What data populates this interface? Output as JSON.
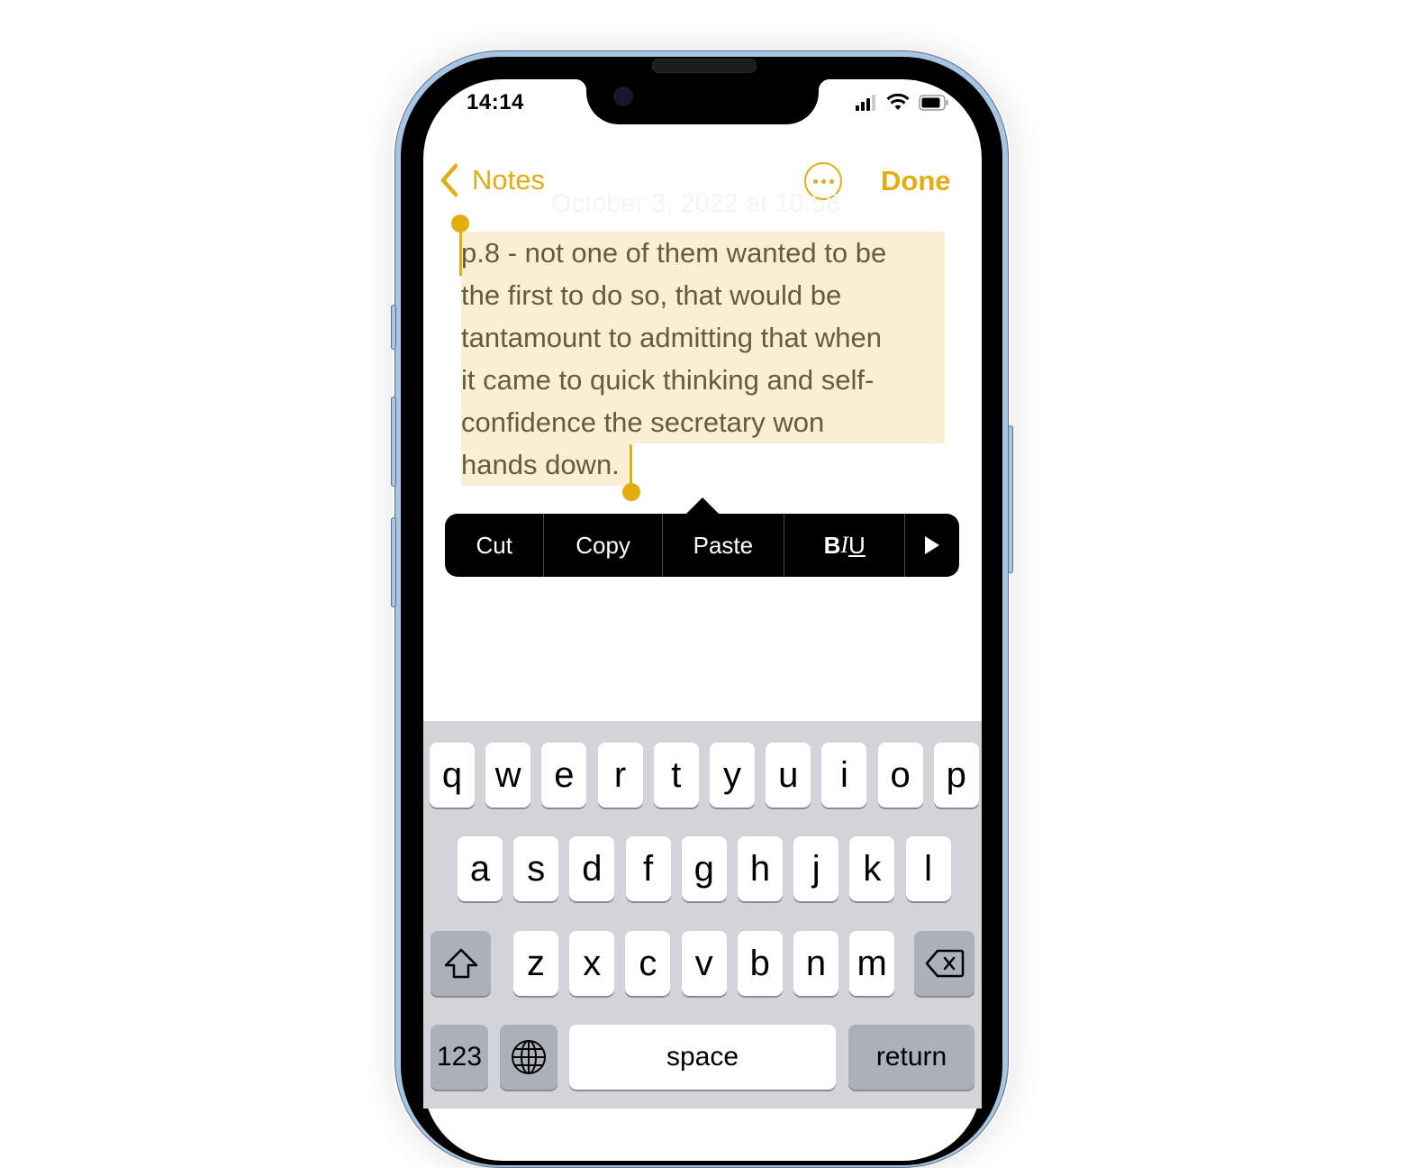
{
  "status_bar": {
    "time": "14:14",
    "signal_icon": "cellular-signal-icon",
    "wifi_icon": "wifi-icon",
    "battery_icon": "battery-icon"
  },
  "nav": {
    "back_label": "Notes",
    "back_icon": "chevron-left-icon",
    "more_icon": "ellipsis-circle-icon",
    "done_label": "Done",
    "accent_color": "#e3ad0f"
  },
  "note": {
    "date": "October 3, 2022 at 10:58",
    "lines": [
      "p.8 - not one of them wanted to be",
      "the first to do so, that would be",
      "tantamount to admitting that when",
      "it came to quick thinking and self-",
      "confidence the secretary won",
      "hands down."
    ],
    "selection_color": "#faefd2"
  },
  "context_menu": {
    "items": [
      "Cut",
      "Copy",
      "Paste",
      "BIU"
    ],
    "more_icon": "play-right-icon"
  },
  "keyboard": {
    "row1": [
      "q",
      "w",
      "e",
      "r",
      "t",
      "y",
      "u",
      "i",
      "o",
      "p"
    ],
    "row2": [
      "a",
      "s",
      "d",
      "f",
      "g",
      "h",
      "j",
      "k",
      "l"
    ],
    "row3": [
      "z",
      "x",
      "c",
      "v",
      "b",
      "n",
      "m"
    ],
    "shift_icon": "shift-icon",
    "delete_icon": "backspace-icon",
    "numbers_label": "123",
    "globe_icon": "globe-icon",
    "space_label": "space",
    "return_label": "return"
  }
}
